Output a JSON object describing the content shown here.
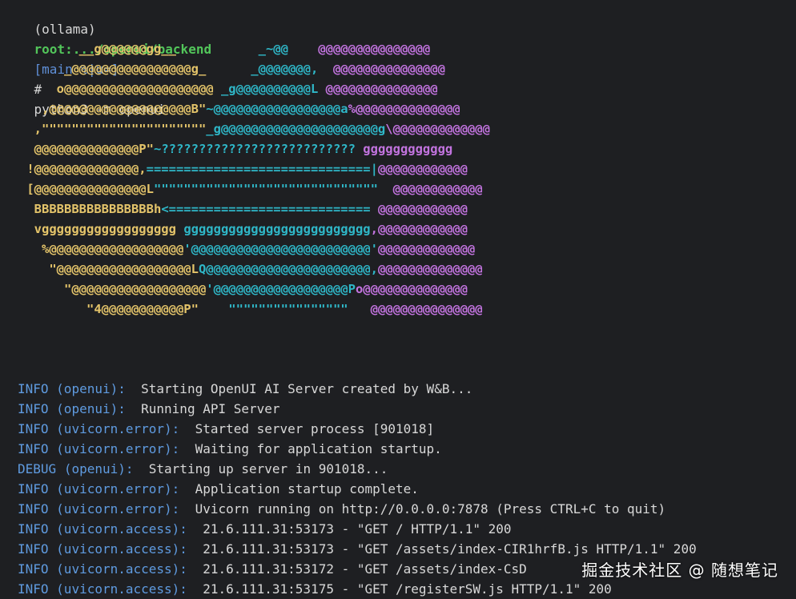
{
  "prompt": {
    "env": "(ollama)",
    "path": "root:.../openui/backend",
    "git": "[main %|u=]",
    "symbol": "#",
    "command": "python3 -m openui"
  },
  "ascii_art": [
    [
      {
        "c": "y",
        "t": "        __g@@@@@@gg__"
      },
      {
        "c": "c",
        "t": "           _~@@    "
      },
      {
        "c": "m",
        "t": "@@@@@@@@@@@@@@@"
      }
    ],
    [
      {
        "c": "y",
        "t": "      _@@@@@@@@@@@@@@@@g_"
      },
      {
        "c": "c",
        "t": "      _@@@@@@@,  "
      },
      {
        "c": "m",
        "t": "@@@@@@@@@@@@@@@"
      }
    ],
    [
      {
        "c": "y",
        "t": "     o@@@@@@@@@@@@@@@@@@@@"
      },
      {
        "c": "c",
        "t": " _g@@@@@@@@@@L "
      },
      {
        "c": "m",
        "t": "@@@@@@@@@@@@@@@"
      }
    ],
    [
      {
        "c": "y",
        "t": "   ,@@@@@@@@@@@@@@@@@@@B\""
      },
      {
        "c": "c",
        "t": "~@@@@@@@@@@@@@@@@@a"
      },
      {
        "c": "m",
        "t": "%@@@@@@@@@@@@@@"
      }
    ],
    [
      {
        "c": "y",
        "t": "  ,\"\"\"\"\"\"\"\"\"\"\"\"\"\"\"\"\"\"\"\"\"\""
      },
      {
        "c": "c",
        "t": "_g@@@@@@@@@@@@@@@@@@@@@g"
      },
      {
        "c": "m",
        "t": "\\@@@@@@@@@@@@@"
      }
    ],
    [
      {
        "c": "y",
        "t": "  @@@@@@@@@@@@@@P\""
      },
      {
        "c": "c",
        "t": "~?????????????????????????? "
      },
      {
        "c": "m",
        "t": "gggggggggggg"
      }
    ],
    [
      {
        "c": "y",
        "t": " !@@@@@@@@@@@@@@,"
      },
      {
        "c": "c",
        "t": "==============================|"
      },
      {
        "c": "m",
        "t": "@@@@@@@@@@@@"
      }
    ],
    [
      {
        "c": "y",
        "t": " [@@@@@@@@@@@@@@@L"
      },
      {
        "c": "c",
        "t": "\"\"\"\"\"\"\"\"\"\"\"\"\"\"\"\"\"\"\"\"\"\"\"\"\"\"\"\"\"\"  "
      },
      {
        "c": "m",
        "t": "@@@@@@@@@@@@"
      }
    ],
    [
      {
        "c": "y",
        "t": "  BBBBBBBBBBBBBBBBh"
      },
      {
        "c": "c",
        "t": "<=========================== "
      },
      {
        "c": "m",
        "t": "@@@@@@@@@@@@"
      }
    ],
    [
      {
        "c": "y",
        "t": "  vgggggggggggggggggg "
      },
      {
        "c": "c",
        "t": "ggggggggggggggggggggggggg"
      },
      {
        "c": "m",
        "t": ",@@@@@@@@@@@@"
      }
    ],
    [
      {
        "c": "y",
        "t": "   %@@@@@@@@@@@@@@@@@@"
      },
      {
        "c": "c",
        "t": "'@@@@@@@@@@@@@@@@@@@@@@@@'"
      },
      {
        "c": "m",
        "t": "@@@@@@@@@@@@@"
      }
    ],
    [
      {
        "c": "y",
        "t": "    \"@@@@@@@@@@@@@@@@@@L"
      },
      {
        "c": "c",
        "t": "Q@@@@@@@@@@@@@@@@@@@@@@,"
      },
      {
        "c": "m",
        "t": "@@@@@@@@@@@@@@"
      }
    ],
    [
      {
        "c": "y",
        "t": "      \"@@@@@@@@@@@@@@@@@@"
      },
      {
        "c": "c",
        "t": "'@@@@@@@@@@@@@@@@@@P"
      },
      {
        "c": "m",
        "t": "o@@@@@@@@@@@@@@"
      }
    ],
    [
      {
        "c": "y",
        "t": "         \"4@@@@@@@@@@@P\""
      },
      {
        "c": "c",
        "t": "    \"\"\"\"\"\"\"\"\"\"\"\"\"\"\"\"   "
      },
      {
        "c": "m",
        "t": "@@@@@@@@@@@@@@@"
      }
    ]
  ],
  "log_lines": [
    {
      "level": "INFO",
      "source": "(openui):",
      "message": "  Starting OpenUI AI Server created by W&B..."
    },
    {
      "level": "INFO",
      "source": "(openui):",
      "message": "  Running API Server"
    },
    {
      "level": "INFO",
      "source": "(uvicorn.error):",
      "message": "  Started server process [901018]"
    },
    {
      "level": "INFO",
      "source": "(uvicorn.error):",
      "message": "  Waiting for application startup."
    },
    {
      "level": "DEBUG",
      "source": "(openui):",
      "message": "  Starting up server in 901018..."
    },
    {
      "level": "INFO",
      "source": "(uvicorn.error):",
      "message": "  Application startup complete."
    },
    {
      "level": "INFO",
      "source": "(uvicorn.error):",
      "message": "  Uvicorn running on http://0.0.0.0:7878 (Press CTRL+C to quit)"
    },
    {
      "level": "INFO",
      "source": "(uvicorn.access):",
      "message": "  21.6.111.31:53173 - \"GET / HTTP/1.1\" 200"
    },
    {
      "level": "INFO",
      "source": "(uvicorn.access):",
      "message": "  21.6.111.31:53173 - \"GET /assets/index-CIR1hrfB.js HTTP/1.1\" 200"
    },
    {
      "level": "INFO",
      "source": "(uvicorn.access):",
      "message": "  21.6.111.31:53172 - \"GET /assets/index-CsD"
    },
    {
      "level": "INFO",
      "source": "(uvicorn.access):",
      "message": "  21.6.111.31:53175 - \"GET /registerSW.js HTTP/1.1\" 200"
    }
  ],
  "watermark": "掘金技术社区 @ 随想笔记",
  "colors": {
    "background": "#1e1f22",
    "art_yellow": "#e4c46a",
    "art_cyan": "#2fb7c8",
    "art_magenta": "#c374e0",
    "log_level": "#5f9be0"
  }
}
